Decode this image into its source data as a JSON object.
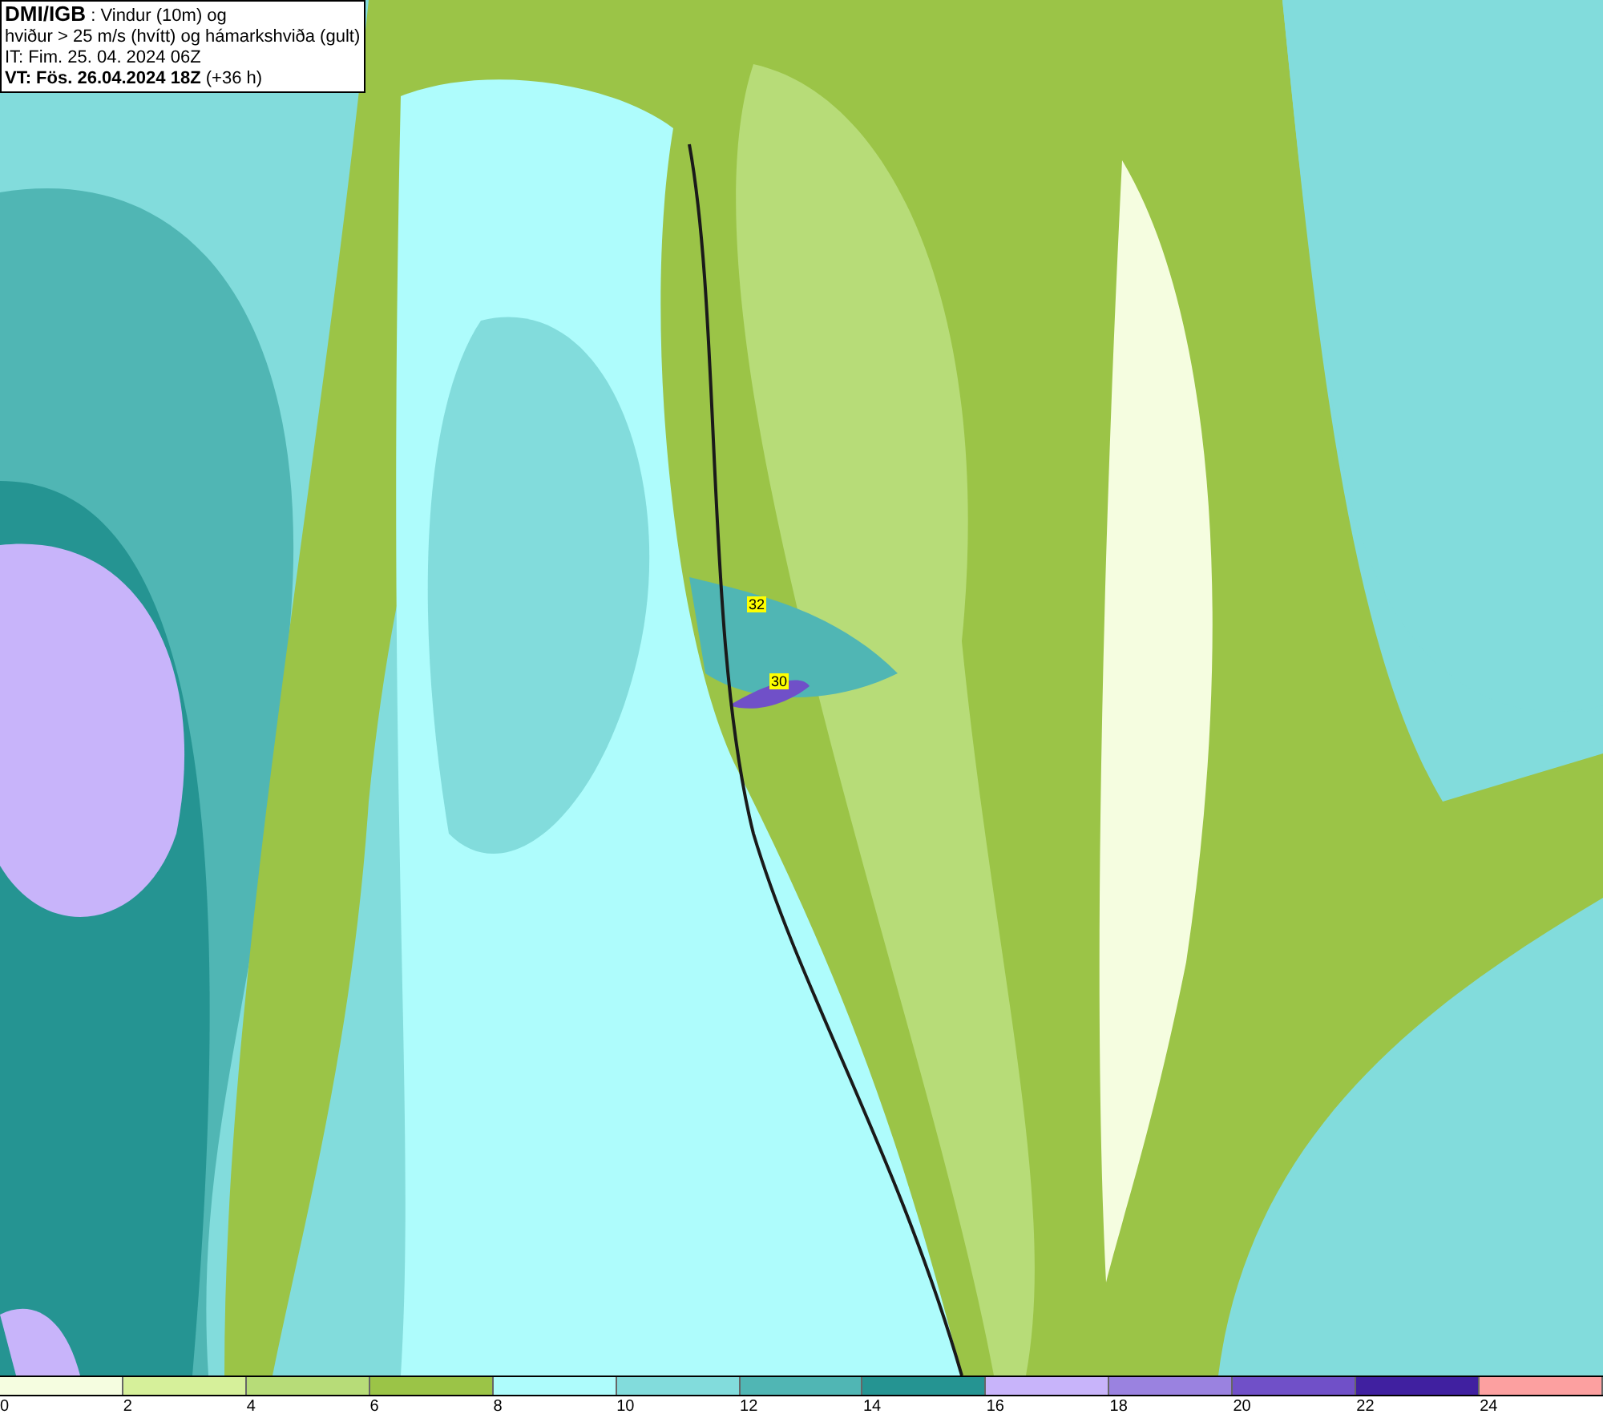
{
  "header": {
    "title": "DMI/IGB",
    "title_rest": ": Vindur (10m) og",
    "line_2": "hviður > 25 m/s (hvítt) og hámarkshviða (gult)",
    "issue_time": "IT: Fim. 25. 04. 2024 06Z",
    "valid_time": "VT: Fös. 26.04.2024 18Z",
    "lead_time": "(+36 h)"
  },
  "gust_labels": [
    "32",
    "30"
  ],
  "legend": [
    {
      "label": "0",
      "color": "#f5fde0"
    },
    {
      "label": "2",
      "color": "#d6f09a"
    },
    {
      "label": "4",
      "color": "#b7dc78"
    },
    {
      "label": "6",
      "color": "#9bc447"
    },
    {
      "label": "8",
      "color": "#aefcfc"
    },
    {
      "label": "10",
      "color": "#82dcdc"
    },
    {
      "label": "12",
      "color": "#50b6b4"
    },
    {
      "label": "14",
      "color": "#259492"
    },
    {
      "label": "16",
      "color": "#c8b4fa"
    },
    {
      "label": "18",
      "color": "#9a82e0"
    },
    {
      "label": "20",
      "color": "#7050c8"
    },
    {
      "label": "22",
      "color": "#4020a0"
    },
    {
      "label": "24",
      "color": "#fca0a0"
    }
  ]
}
